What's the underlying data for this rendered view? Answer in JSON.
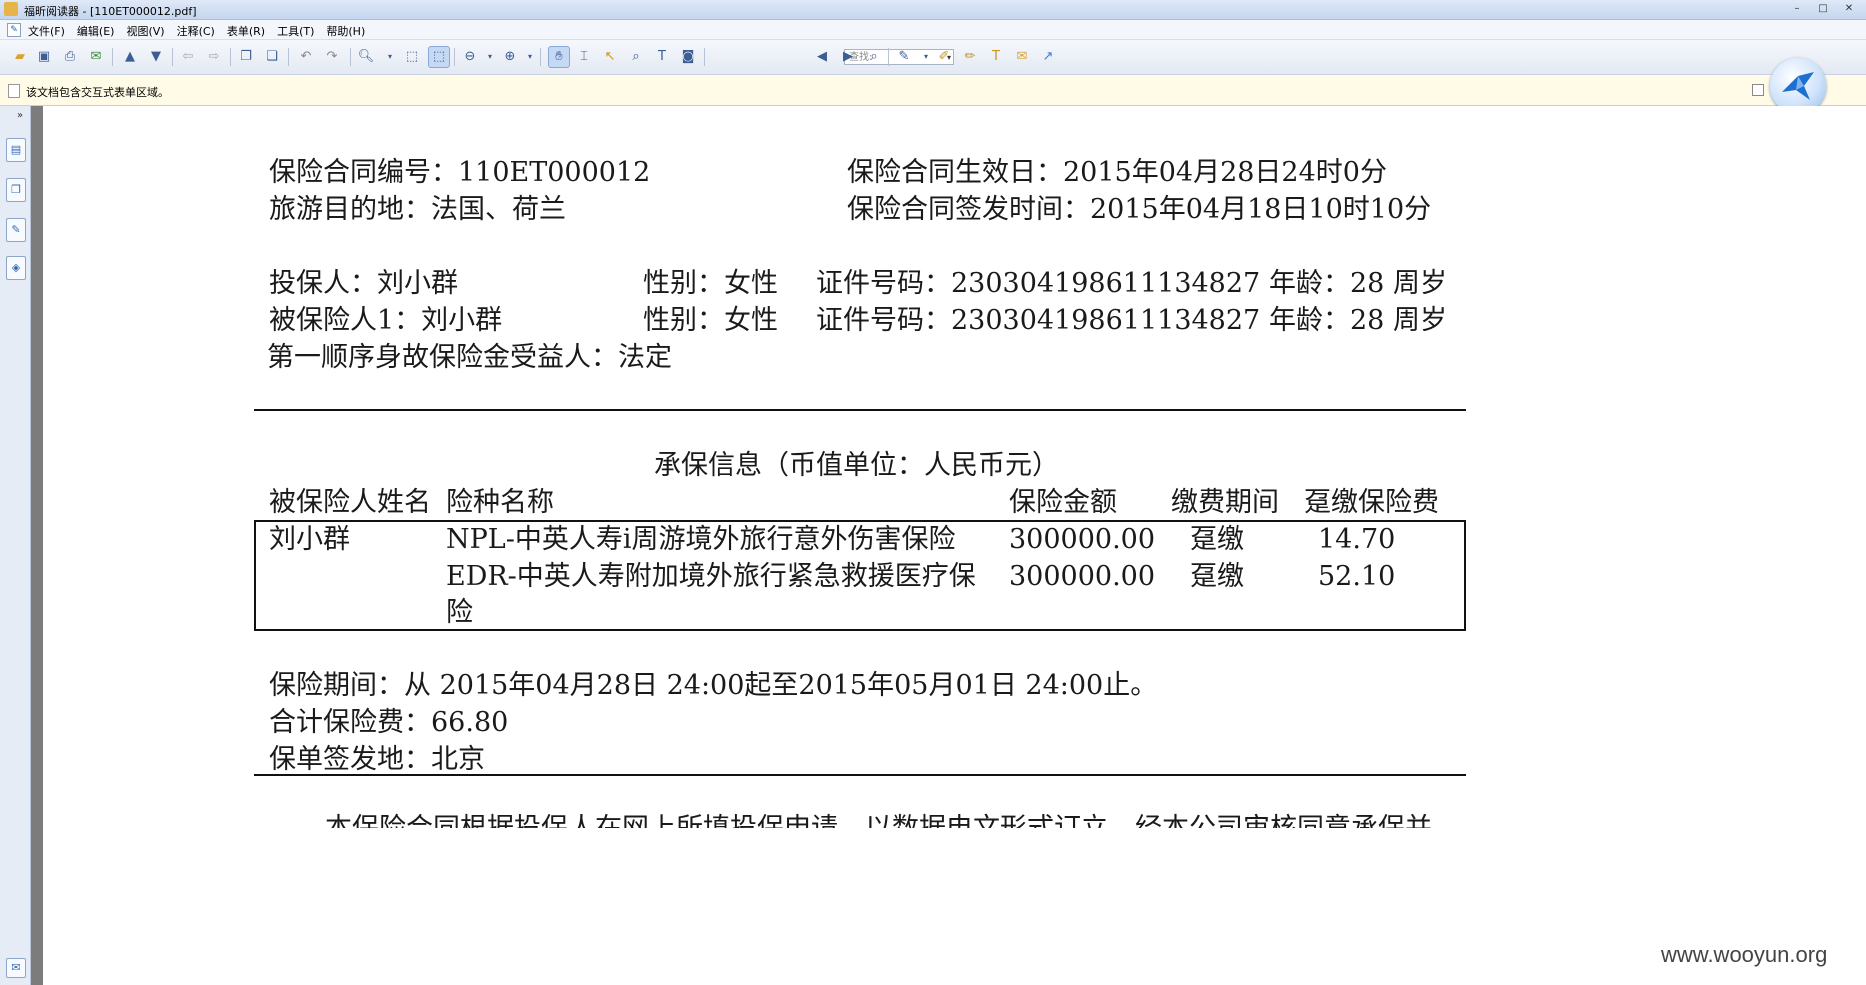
{
  "window": {
    "title": "福昕阅读器 - [110ET000012.pdf]",
    "controls": [
      "–",
      "□",
      "✕"
    ]
  },
  "menu": [
    "文件(F)",
    "编辑(E)",
    "视图(V)",
    "注释(C)",
    "表单(R)",
    "工具(T)",
    "帮助(H)"
  ],
  "toolbar": {
    "find_placeholder": "查找:"
  },
  "infobar": {
    "text": "该文档包含交互式表单区域。"
  },
  "document": {
    "contract_no": "保险合同编号：110ET000012",
    "effective_date": "保险合同生效日：2015年04月28日24时0分",
    "destination": "旅游目的地：法国、荷兰",
    "issue_time": "保险合同签发时间：2015年04月18日10时10分",
    "applicant": {
      "name": "投保人：刘小群",
      "gender": "性别：女性",
      "id": "证件号码：230304198611134827",
      "age": "年龄：28 周岁"
    },
    "insured": {
      "name": "被保险人1：刘小群",
      "gender": "性别：女性",
      "id": "证件号码：230304198611134827",
      "age": "年龄：28 周岁"
    },
    "beneficiary": "第一顺序身故保险金受益人：法定",
    "coverage_title": "承保信息（币值单位：人民币元）",
    "table_headers": [
      "被保险人姓名",
      "险种名称",
      "保险金额",
      "缴费期间",
      "趸缴保险费"
    ],
    "table_rows": [
      {
        "insured": "刘小群",
        "product": "NPL-中英人寿i周游境外旅行意外伤害保险",
        "amount": "300000.00",
        "period": "趸缴",
        "premium": "14.70"
      },
      {
        "insured": "",
        "product": "EDR-中英人寿附加境外旅行紧急救援医疗保",
        "product_cont": "险",
        "amount": "300000.00",
        "period": "趸缴",
        "premium": "52.10"
      }
    ],
    "period": "保险期间：从 2015年04月28日 24:00起至2015年05月01日 24:00止。",
    "total_premium": "合计保险费：66.80",
    "issue_place": "保单签发地：北京",
    "truncated_line": "本保险合同根据投保人在网上所填投保申请，以数据电文形式订立，经本公司审核同意承保并"
  },
  "watermark": "www.wooyun.org"
}
